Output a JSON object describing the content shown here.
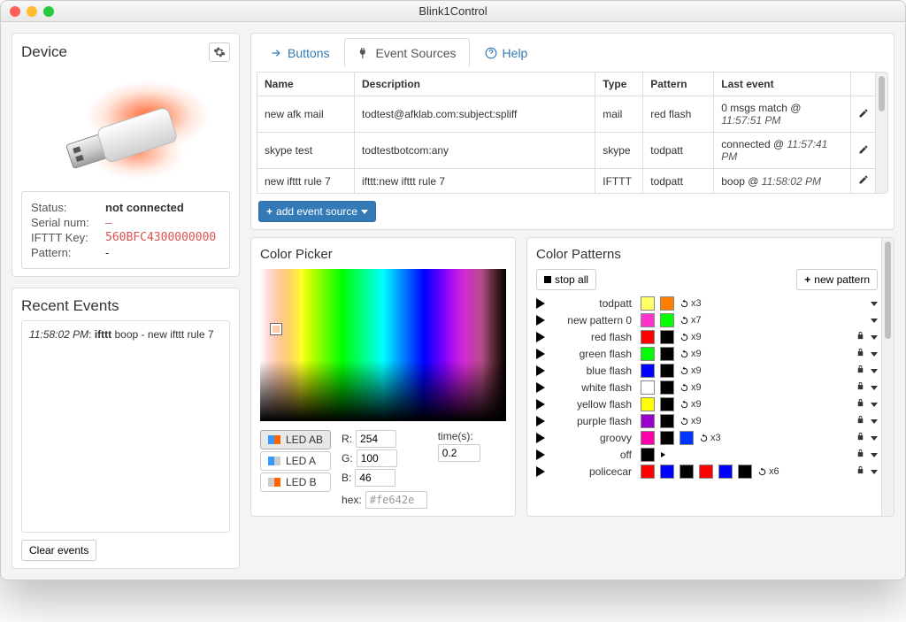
{
  "window": {
    "title": "Blink1Control"
  },
  "device": {
    "panel_title": "Device",
    "status_label": "Status:",
    "status_value": "not connected",
    "serial_label": "Serial num:",
    "serial_value": "–",
    "ifttt_label": "IFTTT Key:",
    "ifttt_value": "560BFC4300000000",
    "pattern_label": "Pattern:",
    "pattern_value": "-"
  },
  "recent": {
    "panel_title": "Recent Events",
    "clear_label": "Clear events",
    "events": [
      {
        "ts": "11:58:02 PM",
        "text": "ifttt boop - new ifttt rule 7"
      }
    ]
  },
  "tabs": {
    "buttons": "Buttons",
    "event_sources": "Event Sources",
    "help": "Help"
  },
  "events_table": {
    "headers": {
      "name": "Name",
      "description": "Description",
      "type": "Type",
      "pattern": "Pattern",
      "last": "Last event"
    },
    "rows": [
      {
        "name": "new afk mail",
        "desc": "todtest@afklab.com:subject:spliff",
        "type": "mail",
        "pattern": "red flash",
        "last_text": "0 msgs match @",
        "last_ts": "11:57:51 PM"
      },
      {
        "name": "skype test",
        "desc": "todtestbotcom:any",
        "type": "skype",
        "pattern": "todpatt",
        "last_text": "connected @",
        "last_ts": "11:57:41 PM"
      },
      {
        "name": "new ifttt rule 7",
        "desc": "ifttt:new ifttt rule 7",
        "type": "IFTTT",
        "pattern": "todpatt",
        "last_text": "boop @",
        "last_ts": "11:58:02 PM"
      }
    ],
    "add_label": "add event source"
  },
  "color_picker": {
    "title": "Color Picker",
    "led_ab": "LED AB",
    "led_a": "LED A",
    "led_b": "LED B",
    "r_label": "R:",
    "r_value": "254",
    "g_label": "G:",
    "g_value": "100",
    "b_label": "B:",
    "b_value": "46",
    "hex_label": "hex:",
    "hex_value": "#fe642e",
    "time_label": "time(s):",
    "time_value": "0.2"
  },
  "patterns": {
    "title": "Color Patterns",
    "stop_all": "stop all",
    "new_pattern": "new pattern",
    "list": [
      {
        "name": "todpatt",
        "colors": [
          "#ffff66",
          "#ff8000"
        ],
        "repeat": "x3",
        "locked": false
      },
      {
        "name": "new pattern 0",
        "colors": [
          "#ff33cc",
          "#00ff00"
        ],
        "repeat": "x7",
        "locked": false
      },
      {
        "name": "red flash",
        "colors": [
          "#ff0000",
          "#000000"
        ],
        "repeat": "x9",
        "locked": true
      },
      {
        "name": "green flash",
        "colors": [
          "#00ff00",
          "#000000"
        ],
        "repeat": "x9",
        "locked": true
      },
      {
        "name": "blue flash",
        "colors": [
          "#0000ff",
          "#000000"
        ],
        "repeat": "x9",
        "locked": true
      },
      {
        "name": "white flash",
        "colors": [
          "#ffffff",
          "#000000"
        ],
        "repeat": "x9",
        "locked": true
      },
      {
        "name": "yellow flash",
        "colors": [
          "#ffff00",
          "#000000"
        ],
        "repeat": "x9",
        "locked": true
      },
      {
        "name": "purple flash",
        "colors": [
          "#9900cc",
          "#000000"
        ],
        "repeat": "x9",
        "locked": true
      },
      {
        "name": "groovy",
        "colors": [
          "#ff00aa",
          "#000000",
          "#0033ff"
        ],
        "repeat": "x3",
        "locked": true
      },
      {
        "name": "off",
        "colors": [
          "#000000"
        ],
        "repeat": "",
        "locked": true,
        "arrow": true
      },
      {
        "name": "policecar",
        "colors": [
          "#ff0000",
          "#0000ff",
          "#000000",
          "#ff0000",
          "#0000ff",
          "#000000"
        ],
        "repeat": "x6",
        "locked": true
      }
    ]
  }
}
